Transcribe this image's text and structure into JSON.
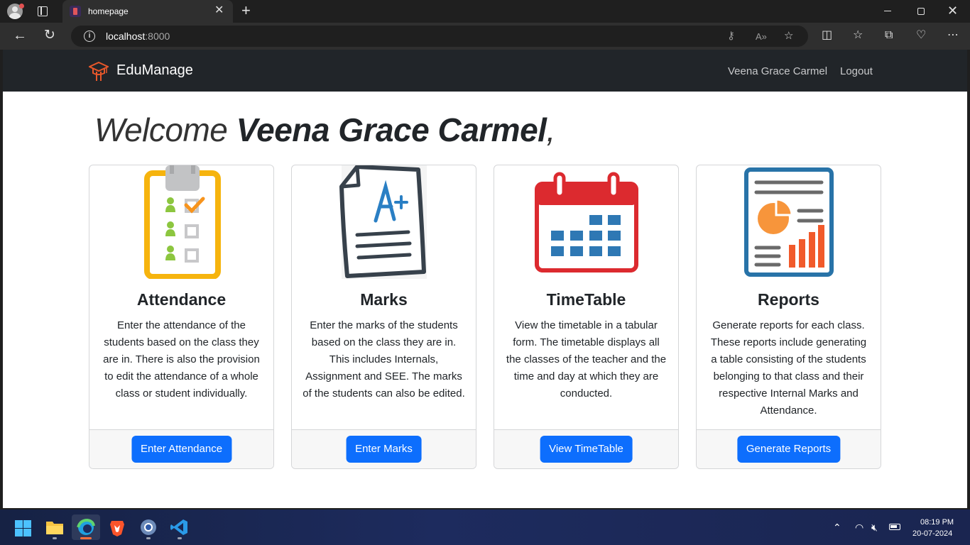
{
  "browser": {
    "tab_title": "homepage",
    "new_tab_symbol": "+",
    "url_host": "localhost",
    "url_port": ":8000"
  },
  "navbar": {
    "brand": "EduManage",
    "user": "Veena Grace Carmel",
    "logout": "Logout"
  },
  "welcome": {
    "greeting": "Welcome",
    "name": "Veena Grace Carmel",
    "punct": ","
  },
  "cards": [
    {
      "icon": "attendance-clipboard-icon",
      "title": "Attendance",
      "text": "Enter the attendance of the students based on the class they are in. There is also the provision to edit the attendance of a whole class or student individually.",
      "button": "Enter Attendance"
    },
    {
      "icon": "marks-paper-icon",
      "title": "Marks",
      "text": "Enter the marks of the students based on the class they are in. This includes Internals, Assignment and SEE. The marks of the students can also be edited.",
      "button": "Enter Marks"
    },
    {
      "icon": "calendar-icon",
      "title": "TimeTable",
      "text": "View the timetable in a tabular form. The timetable displays all the classes of the teacher and the time and day at which they are conducted.",
      "button": "View TimeTable"
    },
    {
      "icon": "report-chart-icon",
      "title": "Reports",
      "text": "Generate reports for each class. These reports include generating a table consisting of the students belonging to that class and their respective Internal Marks and Attendance.",
      "button": "Generate Reports"
    }
  ],
  "taskbar": {
    "time": "08:19 PM",
    "date": "20-07-2024"
  },
  "colors": {
    "navbar_bg": "#212529",
    "primary_button": "#0d6efd",
    "logo_orange": "#e8572a"
  }
}
